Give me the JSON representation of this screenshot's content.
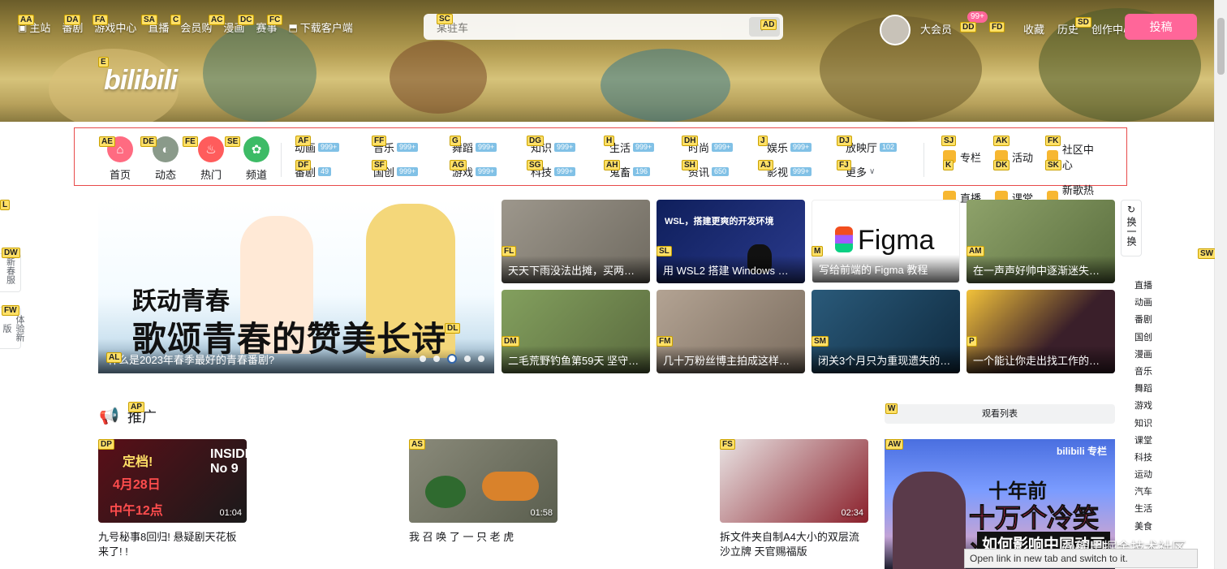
{
  "top_nav": {
    "items": [
      {
        "label": "主站",
        "icon": "tv-icon",
        "hint": "AA"
      },
      {
        "label": "番剧",
        "icon": "",
        "hint": "DA"
      },
      {
        "label": "游戏中心",
        "icon": "",
        "hint": "FA"
      },
      {
        "label": "直播",
        "icon": "",
        "hint": "SA"
      },
      {
        "label": "会员购",
        "icon": "",
        "hint": "C"
      },
      {
        "label": "漫画",
        "icon": "",
        "hint": "AC"
      },
      {
        "label": "赛事",
        "icon": "",
        "hint": "DC"
      },
      {
        "label": "下载客户端",
        "icon": "download-icon",
        "hint": "FC"
      }
    ]
  },
  "search": {
    "placeholder": "某驻车",
    "hint": "SC",
    "button_hint": "AD"
  },
  "right_nav": {
    "items": [
      {
        "label": "大会员",
        "hint": ""
      },
      {
        "label": "",
        "hint": "DD"
      },
      {
        "label": "",
        "hint": "FD"
      },
      {
        "label": "收藏",
        "hint": ""
      },
      {
        "label": "历史",
        "hint": ""
      },
      {
        "label": "创作中心",
        "hint": "SD"
      }
    ],
    "badge": "99+",
    "upload_label": "投稿"
  },
  "logo": {
    "text": "bilibili",
    "hint": "E"
  },
  "quick": [
    {
      "label": "首页",
      "hint": "AE",
      "color": "#ff6b81"
    },
    {
      "label": "动态",
      "hint": "DE",
      "color": "#8a9a8a"
    },
    {
      "label": "热门",
      "hint": "FE",
      "color": "#ff5c5c"
    },
    {
      "label": "频道",
      "hint": "SE",
      "color": "#3dbb66"
    }
  ],
  "channels": [
    {
      "label": "动画",
      "count": "999+",
      "hint": "AF"
    },
    {
      "label": "音乐",
      "count": "999+",
      "hint": "FF"
    },
    {
      "label": "舞蹈",
      "count": "999+",
      "hint": "G"
    },
    {
      "label": "知识",
      "count": "999+",
      "hint": "DG"
    },
    {
      "label": "生活",
      "count": "999+",
      "hint": "H"
    },
    {
      "label": "时尚",
      "count": "999+",
      "hint": "DH"
    },
    {
      "label": "娱乐",
      "count": "999+",
      "hint": "J"
    },
    {
      "label": "放映厅",
      "count": "102",
      "hint": "DJ"
    },
    {
      "label": "番剧",
      "count": "49",
      "hint": "DF"
    },
    {
      "label": "国创",
      "count": "999+",
      "hint": "SF"
    },
    {
      "label": "游戏",
      "count": "999+",
      "hint": "AG"
    },
    {
      "label": "科技",
      "count": "999+",
      "hint": "SG"
    },
    {
      "label": "鬼畜",
      "count": "196",
      "hint": "AH"
    },
    {
      "label": "资讯",
      "count": "650",
      "hint": "SH"
    },
    {
      "label": "影视",
      "count": "999+",
      "hint": "AJ"
    },
    {
      "label": "更多",
      "count": "",
      "hint": "FJ"
    }
  ],
  "side_links": [
    {
      "label": "专栏",
      "hint": "SJ"
    },
    {
      "label": "活动",
      "hint": "AK"
    },
    {
      "label": "社区中心",
      "hint": "FK"
    },
    {
      "label": "直播",
      "hint": "K"
    },
    {
      "label": "课堂",
      "hint": "DK"
    },
    {
      "label": "新歌热榜",
      "hint": "SK"
    }
  ],
  "carousel": {
    "line1": "跃动青春",
    "line2": "歌颂青春的赞美长诗",
    "caption": "什么是2023年春季最好的青春番剧?",
    "hint": "AL",
    "hint2": "DL",
    "slides": 5,
    "active": 3
  },
  "feed_cards": [
    {
      "title": "天天下雨没法出摊，买两斤…",
      "hint": "FL",
      "bg": "#8f8a80"
    },
    {
      "title": "用 WSL2 搭建 Windows 上…",
      "hint": "SL",
      "bg": "#1a2a6b"
    },
    {
      "title": "写给前端的 Figma 教程",
      "hint": "M",
      "bg": "#ffffff"
    },
    {
      "title": "在一声声好帅中逐渐迷失了…",
      "hint": "AM",
      "bg": "#7a8f5a"
    },
    {
      "title": "二毛荒野钓鱼第59天 坚守…",
      "hint": "DM",
      "bg": "#6f8a4e"
    },
    {
      "title": "几十万粉丝博主拍成这样，…",
      "hint": "FM",
      "bg": "#a09080"
    },
    {
      "title": "闭关3个月只为重现遗失的…",
      "hint": "SM",
      "bg": "#1f4a6a"
    },
    {
      "title": "一个能让你走出找工作的困…",
      "hint": "P",
      "bg": "#3a1f2a"
    }
  ],
  "figma_text": "Figma",
  "wsl_text": "WSL，搭建更爽的开发环境",
  "refresh_label": "换一换",
  "left_float": [
    {
      "label": "新春服",
      "hint": "DW"
    },
    {
      "label": "体验新版",
      "hint": "FW"
    }
  ],
  "left_hint": "L",
  "right_hint": "SW",
  "category_list": [
    "直播",
    "动画",
    "番剧",
    "国创",
    "漫画",
    "音乐",
    "舞蹈",
    "游戏",
    "知识",
    "课堂",
    "科技",
    "运动",
    "汽车",
    "生活",
    "美食"
  ],
  "promo": {
    "title": "推广",
    "hint": "AP"
  },
  "watchlist": {
    "label": "观看列表",
    "hint": "W"
  },
  "videos": [
    {
      "title": "九号秘事8回归! 悬疑剧天花板来了! !",
      "duration": "01:04",
      "hint": "DP",
      "overlay1": "定档!",
      "overlay2": "4月28日",
      "overlay3": "中午12点",
      "overlay4": "INSIDE No 9"
    },
    {
      "title": "我 召 唤 了 一 只 老 虎",
      "duration": "01:58",
      "hint": "AS"
    },
    {
      "title": "拆文件夹自制A4大小的双层流沙立牌 天官赐福版",
      "duration": "02:34",
      "hint": "FS"
    }
  ],
  "big_ad": {
    "line1": "十年前",
    "line2": "十万个冷笑话",
    "line3": "如何影响中国动画",
    "brand": "bilibili 专栏",
    "hint": "AW"
  },
  "status_text": "Open link in new tab and switch to it.",
  "watermark": "@稀土掘金技术社区"
}
